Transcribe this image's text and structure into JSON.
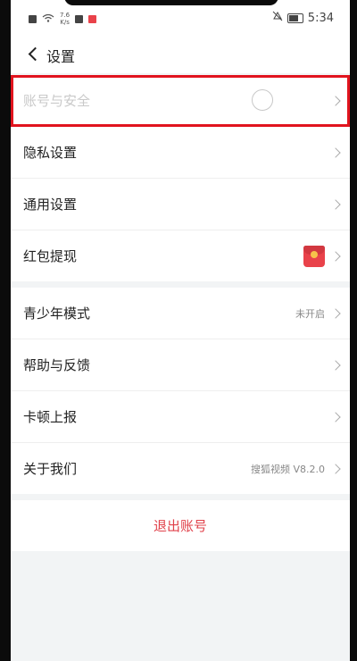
{
  "status_bar": {
    "net_speed_top": "7.6",
    "net_speed_bottom": "K/s",
    "time": "5:34"
  },
  "header": {
    "title": "设置"
  },
  "group1": [
    {
      "label": "账号与安全",
      "highlighted": true
    },
    {
      "label": "隐私设置"
    },
    {
      "label": "通用设置"
    },
    {
      "label": "红包提现",
      "icon": "red-envelope-icon"
    }
  ],
  "group2": [
    {
      "label": "青少年模式",
      "value": "未开启"
    },
    {
      "label": "帮助与反馈"
    },
    {
      "label": "卡顿上报"
    },
    {
      "label": "关于我们",
      "value": "搜狐视频 V8.2.0"
    }
  ],
  "logout": {
    "label": "退出账号"
  },
  "colors": {
    "highlight_border": "#e1141e",
    "logout_text": "#e0414a",
    "background": "#f2f4f5"
  }
}
